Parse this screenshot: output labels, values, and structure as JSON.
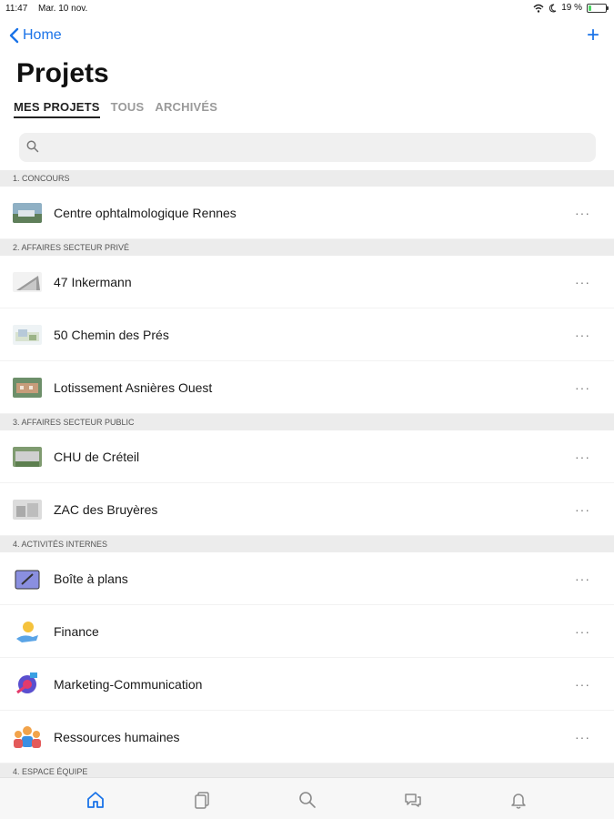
{
  "status": {
    "time": "11:47",
    "date": "Mar. 10 nov.",
    "battery": "19 %",
    "battery_level": 0.19
  },
  "nav": {
    "back_label": "Home",
    "add_label": "+"
  },
  "title": "Projets",
  "tabs": [
    "MES PROJETS",
    "TOUS",
    "ARCHIVÉS"
  ],
  "search": {
    "value": "",
    "placeholder": ""
  },
  "sections": [
    {
      "header": "1. CONCOURS",
      "items": [
        {
          "label": "Centre ophtalmologique Rennes",
          "icon": "project-photo-icon"
        }
      ]
    },
    {
      "header": "2. AFFAIRES SECTEUR PRIVÉ",
      "items": [
        {
          "label": "47 Inkermann",
          "icon": "project-photo-icon"
        },
        {
          "label": "50 Chemin des Prés",
          "icon": "project-photo-icon"
        },
        {
          "label": "Lotissement Asnières Ouest",
          "icon": "project-photo-icon"
        }
      ]
    },
    {
      "header": "3. AFFAIRES SECTEUR PUBLIC",
      "items": [
        {
          "label": "CHU de Créteil",
          "icon": "project-photo-icon"
        },
        {
          "label": "ZAC des Bruyères",
          "icon": "project-photo-icon"
        }
      ]
    },
    {
      "header": "4. ACTIVITÉS INTERNES",
      "items": [
        {
          "label": "Boîte à plans",
          "icon": "blueprint-icon"
        },
        {
          "label": "Finance",
          "icon": "finance-icon"
        },
        {
          "label": "Marketing-Communication",
          "icon": "marketing-icon"
        },
        {
          "label": "Ressources humaines",
          "icon": "people-icon"
        }
      ]
    },
    {
      "header": "4. ESPACE ÉQUIPE",
      "items": []
    }
  ],
  "more_label": "···",
  "tabbar": [
    "home-icon",
    "documents-icon",
    "search-icon",
    "chat-icon",
    "bell-icon"
  ],
  "colors": {
    "accent": "#1a73e8",
    "section_bg": "#ececec"
  }
}
